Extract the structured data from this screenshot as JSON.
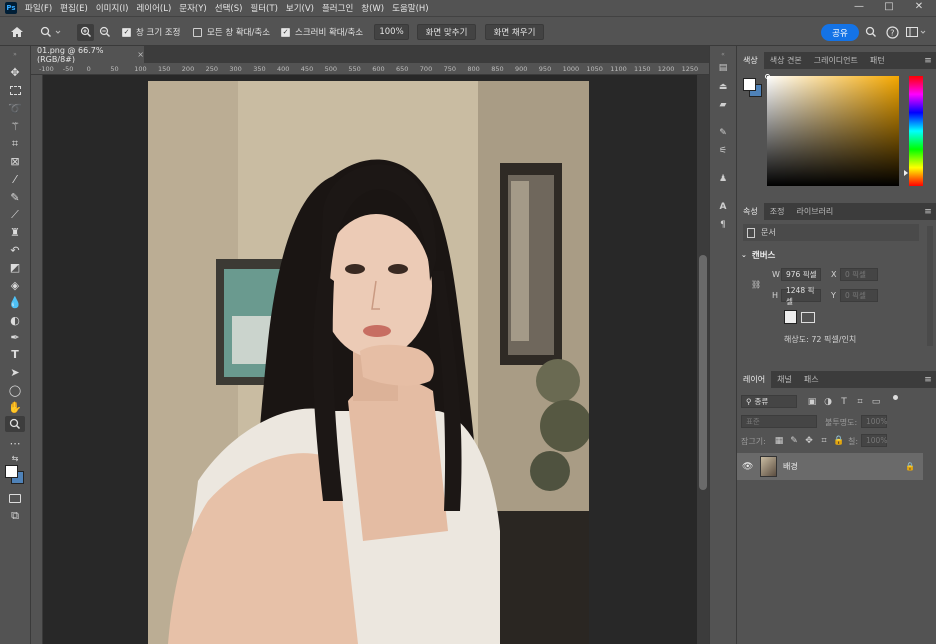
{
  "menubar": {
    "logo": "Ps",
    "items": [
      "파일(F)",
      "편집(E)",
      "이미지(I)",
      "레이어(L)",
      "문자(Y)",
      "선택(S)",
      "필터(T)",
      "보기(V)",
      "플러그인",
      "창(W)",
      "도움말(H)"
    ],
    "minimize": "—",
    "maximize": "□",
    "close": "✕"
  },
  "options": {
    "resize_windows": "창 크기 조정",
    "zoom_all": "모든 창 확대/축소",
    "scrubby_zoom": "스크러비 확대/축소",
    "zoom_value": "100%",
    "fit_screen": "화면 맞추기",
    "fill_screen": "화면 채우기",
    "share": "공유"
  },
  "document": {
    "tab_title": "01.png @ 66.7% (RGB/8#)",
    "tab_close": "×",
    "ruler_ticks": [
      "-100",
      "-50",
      "0",
      "50",
      "100",
      "150",
      "200",
      "250",
      "300",
      "350",
      "400",
      "450",
      "500",
      "550",
      "600",
      "650",
      "700",
      "750",
      "800",
      "850",
      "900",
      "950",
      "1000",
      "1050",
      "1100",
      "1150",
      "1200",
      "1250"
    ]
  },
  "color_panel": {
    "tabs": [
      "색상",
      "색상 견본",
      "그레이디언트",
      "패턴"
    ]
  },
  "properties_panel": {
    "tabs": [
      "속성",
      "조정",
      "라이브러리"
    ],
    "doc_label": "문서",
    "canvas_section": "캔버스",
    "w_label": "W",
    "w_value": "976 픽셀",
    "h_label": "H",
    "h_value": "1248 픽셀",
    "x_label": "X",
    "x_value": "0 픽셀",
    "y_label": "Y",
    "y_value": "0 픽셀",
    "resolution": "해상도: 72 픽셀/인치"
  },
  "layers_panel": {
    "tabs": [
      "레이어",
      "채널",
      "패스"
    ],
    "filter_label": "종류",
    "blend_mode": "표준",
    "opacity_label": "불투명도:",
    "opacity_value": "100%",
    "lock_label": "잠그기:",
    "fill_label": "칠:",
    "fill_value": "100%",
    "layer_name": "배경"
  },
  "colors": {
    "accent": "#1473e6",
    "panel_bg": "#535353",
    "canvas_bg": "#282828"
  }
}
